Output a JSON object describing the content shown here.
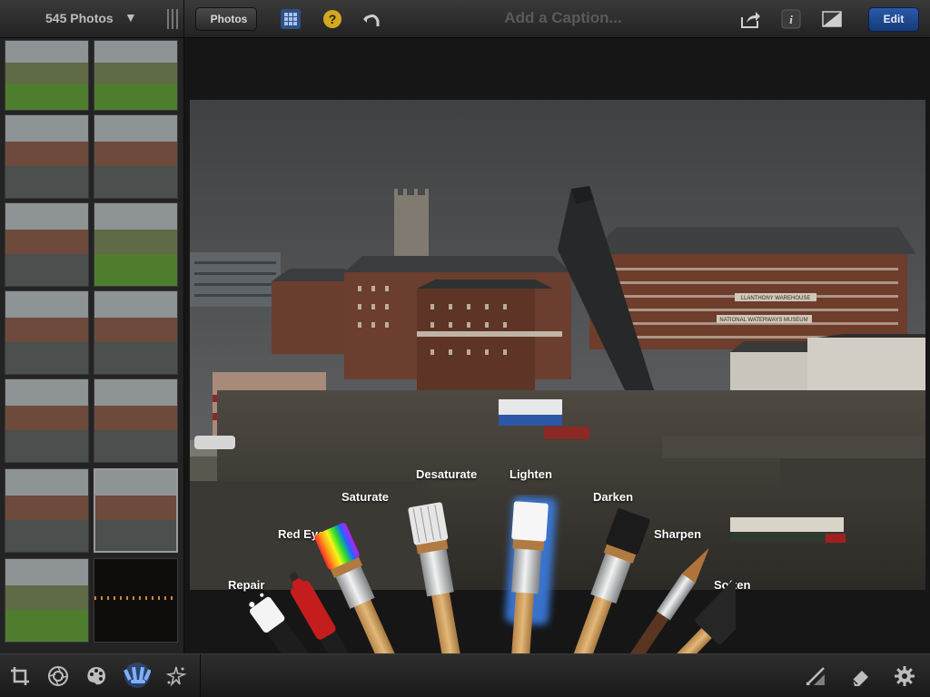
{
  "topbar": {
    "album_count": "545 Photos",
    "album_arrow": "▼",
    "photos_button": "Photos",
    "caption_placeholder": "Add a Caption...",
    "edit_button": "Edit",
    "icons": [
      "grid-icon",
      "help-icon",
      "undo-icon",
      "share-icon",
      "info-icon",
      "compare-icon"
    ]
  },
  "sidebar": {
    "thumbnails": [
      {
        "style": "green"
      },
      {
        "style": "green"
      },
      {
        "style": "canal"
      },
      {
        "style": "canal"
      },
      {
        "style": "canal"
      },
      {
        "style": "green"
      },
      {
        "style": "canal"
      },
      {
        "style": "canal"
      },
      {
        "style": "canal"
      },
      {
        "style": "canal"
      },
      {
        "style": "canal"
      },
      {
        "style": "canal",
        "selected": true
      },
      {
        "style": "green"
      },
      {
        "style": "night"
      }
    ]
  },
  "brush_labels": {
    "repair": "Repair",
    "red_eye": "Red Eye",
    "saturate": "Saturate",
    "desaturate": "Desaturate",
    "lighten": "Lighten",
    "darken": "Darken",
    "sharpen": "Sharpen",
    "soften": "Soften"
  },
  "active_brush": "Lighten",
  "photo_signs": {
    "warehouse_1": "LLANTHONY WAREHOUSE",
    "warehouse_2": "NATIONAL WATERWAYS MUSEUM"
  },
  "bottombar": {
    "tools": [
      "crop-icon",
      "exposure-icon",
      "color-icon",
      "brushes-icon",
      "effects-icon"
    ],
    "active_tool": "brushes-icon",
    "right_tools": [
      "brush-settings-icon",
      "eraser-icon",
      "gear-icon"
    ]
  },
  "colors": {
    "accent_blue": "#3b7be0",
    "toolbar_bg": "#2b2b2b",
    "edit_button": "#2a5aa8"
  }
}
